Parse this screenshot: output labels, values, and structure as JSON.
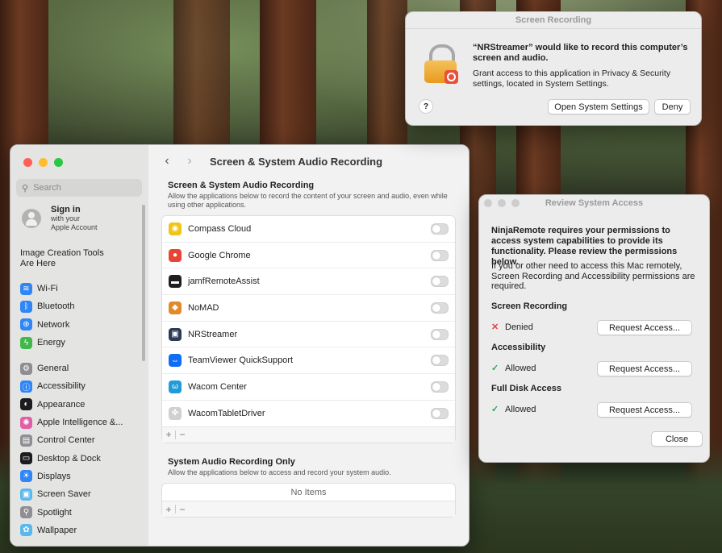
{
  "settings": {
    "search_placeholder": "Search",
    "signin": {
      "title": "Sign in",
      "line1": "with your",
      "line2": "Apple Account"
    },
    "image_tools": "Image Creation Tools Are Here",
    "nav_group1": [
      {
        "label": "Wi-Fi",
        "icon": "wifi-icon",
        "color": "#2f86f6",
        "glyph": "≋"
      },
      {
        "label": "Bluetooth",
        "icon": "bluetooth-icon",
        "color": "#2f86f6",
        "glyph": "ᛒ"
      },
      {
        "label": "Network",
        "icon": "globe-icon",
        "color": "#2f86f6",
        "glyph": "⊕"
      },
      {
        "label": "Energy",
        "icon": "energy-icon",
        "color": "#40b84c",
        "glyph": "ϟ"
      }
    ],
    "nav_group2": [
      {
        "label": "General",
        "icon": "gear-icon",
        "color": "#8e8e93",
        "glyph": "⚙"
      },
      {
        "label": "Accessibility",
        "icon": "accessibility-icon",
        "color": "#2f86f6",
        "glyph": "ⓘ"
      },
      {
        "label": "Appearance",
        "icon": "appearance-icon",
        "color": "#1c1c1e",
        "glyph": "◐"
      },
      {
        "label": "Apple Intelligence &...",
        "icon": "apple-intelligence-icon",
        "color": "#e25fa8",
        "glyph": "✺"
      },
      {
        "label": "Control Center",
        "icon": "control-center-icon",
        "color": "#8e8e93",
        "glyph": "▤"
      },
      {
        "label": "Desktop & Dock",
        "icon": "desktop-dock-icon",
        "color": "#1c1c1e",
        "glyph": "▭"
      },
      {
        "label": "Displays",
        "icon": "displays-icon",
        "color": "#2f86f6",
        "glyph": "☀"
      },
      {
        "label": "Screen Saver",
        "icon": "screen-saver-icon",
        "color": "#5ab8f0",
        "glyph": "▣"
      },
      {
        "label": "Spotlight",
        "icon": "spotlight-icon",
        "color": "#8e8e93",
        "glyph": "⚲"
      },
      {
        "label": "Wallpaper",
        "icon": "wallpaper-icon",
        "color": "#5ab8f0",
        "glyph": "✿"
      }
    ],
    "page_title": "Screen & System Audio Recording",
    "section1": {
      "heading": "Screen & System Audio Recording",
      "description": "Allow the applications below to record the content of your screen and audio, even while using other applications.",
      "apps": [
        {
          "name": "Compass Cloud",
          "icon": "compass-cloud-icon",
          "color": "#f0c419",
          "glyph": "◉"
        },
        {
          "name": "Google Chrome",
          "icon": "chrome-icon",
          "color": "#ea4335",
          "glyph": "●"
        },
        {
          "name": "jamfRemoteAssist",
          "icon": "terminal-icon",
          "color": "#1f1f1f",
          "glyph": "▬"
        },
        {
          "name": "NoMAD",
          "icon": "nomad-icon",
          "color": "#e08a2c",
          "glyph": "◆"
        },
        {
          "name": "NRStreamer",
          "icon": "nrstreamer-icon",
          "color": "#2b3a55",
          "glyph": "▣"
        },
        {
          "name": "TeamViewer QuickSupport",
          "icon": "teamviewer-icon",
          "color": "#0e6cf5",
          "glyph": "⇔"
        },
        {
          "name": "Wacom Center",
          "icon": "wacom-icon",
          "color": "#1f9bd7",
          "glyph": "ω"
        },
        {
          "name": "WacomTabletDriver",
          "icon": "wacom-driver-icon",
          "color": "#d0d0d0",
          "glyph": "✤"
        }
      ]
    },
    "section2": {
      "heading": "System Audio Recording Only",
      "description": "Allow the applications below to access and record your system audio.",
      "empty": "No Items"
    },
    "plus": "+",
    "minus": "−"
  },
  "alert": {
    "title": "Screen Recording",
    "message": "“NRStreamer” would like to record this computer’s screen and audio.",
    "detail": "Grant access to this application in Privacy & Security settings, located in System Settings.",
    "help": "?",
    "open_button": "Open System Settings",
    "deny_button": "Deny"
  },
  "review": {
    "title": "Review System Access",
    "intro": "NinjaRemote requires your permissions to access system capabilities to provide its functionality. Please review the permissions below.",
    "detail": "If you or other need to access this Mac remotely, Screen Recording and Accessibility permissions are required.",
    "permissions": [
      {
        "name": "Screen Recording",
        "status": "Denied",
        "mark": "✕",
        "color": "#e0443a",
        "button": "Request Access..."
      },
      {
        "name": "Accessibility",
        "status": "Allowed",
        "mark": "✓",
        "color": "#2fa84f",
        "button": "Request Access..."
      },
      {
        "name": "Full Disk Access",
        "status": "Allowed",
        "mark": "✓",
        "color": "#2fa84f",
        "button": "Request Access..."
      }
    ],
    "close_button": "Close"
  }
}
